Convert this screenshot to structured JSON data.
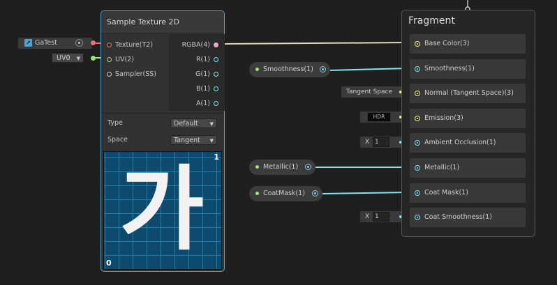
{
  "texture_node": {
    "title": "Sample Texture 2D",
    "inputs": [
      "Texture(T2)",
      "UV(2)",
      "Sampler(SS)"
    ],
    "outputs": [
      "RGBA(4)",
      "R(1)",
      "G(1)",
      "B(1)",
      "A(1)"
    ],
    "type_label": "Type",
    "type_value": "Default",
    "space_label": "Space",
    "space_value": "Tangent",
    "preview_glyph": "가",
    "preview_top": "1",
    "preview_bottom": "0"
  },
  "texture_input": {
    "label": "GaTest"
  },
  "uv_input": {
    "value": "UV0"
  },
  "properties": {
    "smoothness": "Smoothness(1)",
    "metallic": "Metallic(1)",
    "coatmask": "CoatMask(1)"
  },
  "fragment": {
    "title": "Fragment",
    "slots": [
      "Base Color(3)",
      "Smoothness(1)",
      "Normal (Tangent Space)(3)",
      "Emission(3)",
      "Ambient Occlusion(1)",
      "Metallic(1)",
      "Coat Mask(1)",
      "Coat Smoothness(1)"
    ]
  },
  "inline_fields": {
    "tangent_space": "Tangent Space",
    "hdr": "HDR",
    "ao_label": "X",
    "ao_value": "1",
    "coat_label": "X",
    "coat_value": "1"
  },
  "colors": {
    "vector4": "#e8a6c8",
    "vector1": "#84e4ee",
    "vector3": "#f5f08a",
    "uv": "#9fe37a",
    "texture": "#e86f7b",
    "selection": "#4ba7d6"
  }
}
